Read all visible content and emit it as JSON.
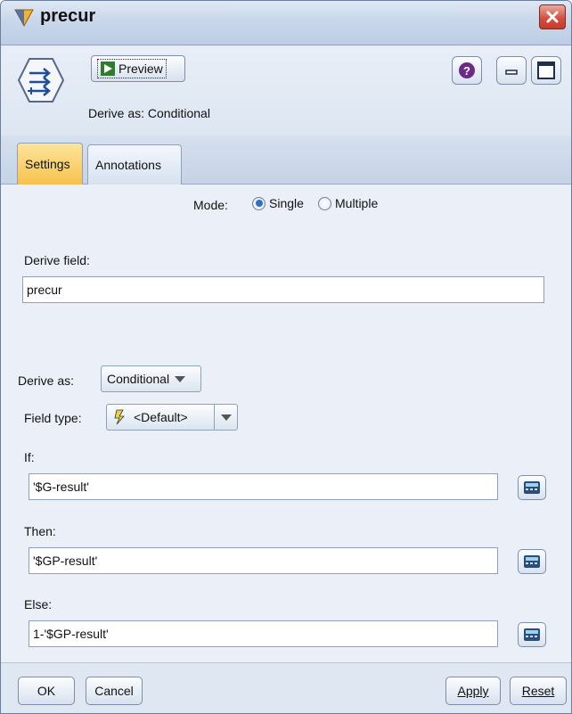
{
  "window": {
    "title": "precur"
  },
  "header": {
    "preview_label": "Preview",
    "derive_as_text": "Derive as: Conditional"
  },
  "tabs": [
    {
      "label": "Settings",
      "active": true
    },
    {
      "label": "Annotations",
      "active": false
    }
  ],
  "settings": {
    "mode_label": "Mode:",
    "mode_options": [
      "Single",
      "Multiple"
    ],
    "mode_selected": "Single",
    "derive_field_label": "Derive field:",
    "derive_field_value": "precur",
    "derive_as_label": "Derive as:",
    "derive_as_value": "Conditional",
    "field_type_label": "Field type:",
    "field_type_value": "<Default>",
    "if_label": "If:",
    "if_value": "'$G-result'",
    "then_label": "Then:",
    "then_value": "'$GP-result'",
    "else_label": "Else:",
    "else_value": "1-'$GP-result'"
  },
  "footer": {
    "ok_label": "OK",
    "cancel_label": "Cancel",
    "apply_label": "Apply",
    "reset_label": "Reset"
  },
  "colors": {
    "active_tab": "#f6c14d",
    "close_button": "#d5503f",
    "help_button": "#6a2a86"
  },
  "icons": [
    "app-icon",
    "close-icon",
    "derive-node-icon",
    "play-icon",
    "help-icon",
    "minimize-icon",
    "maximize-icon",
    "field-type-icon",
    "calculator-icon"
  ]
}
